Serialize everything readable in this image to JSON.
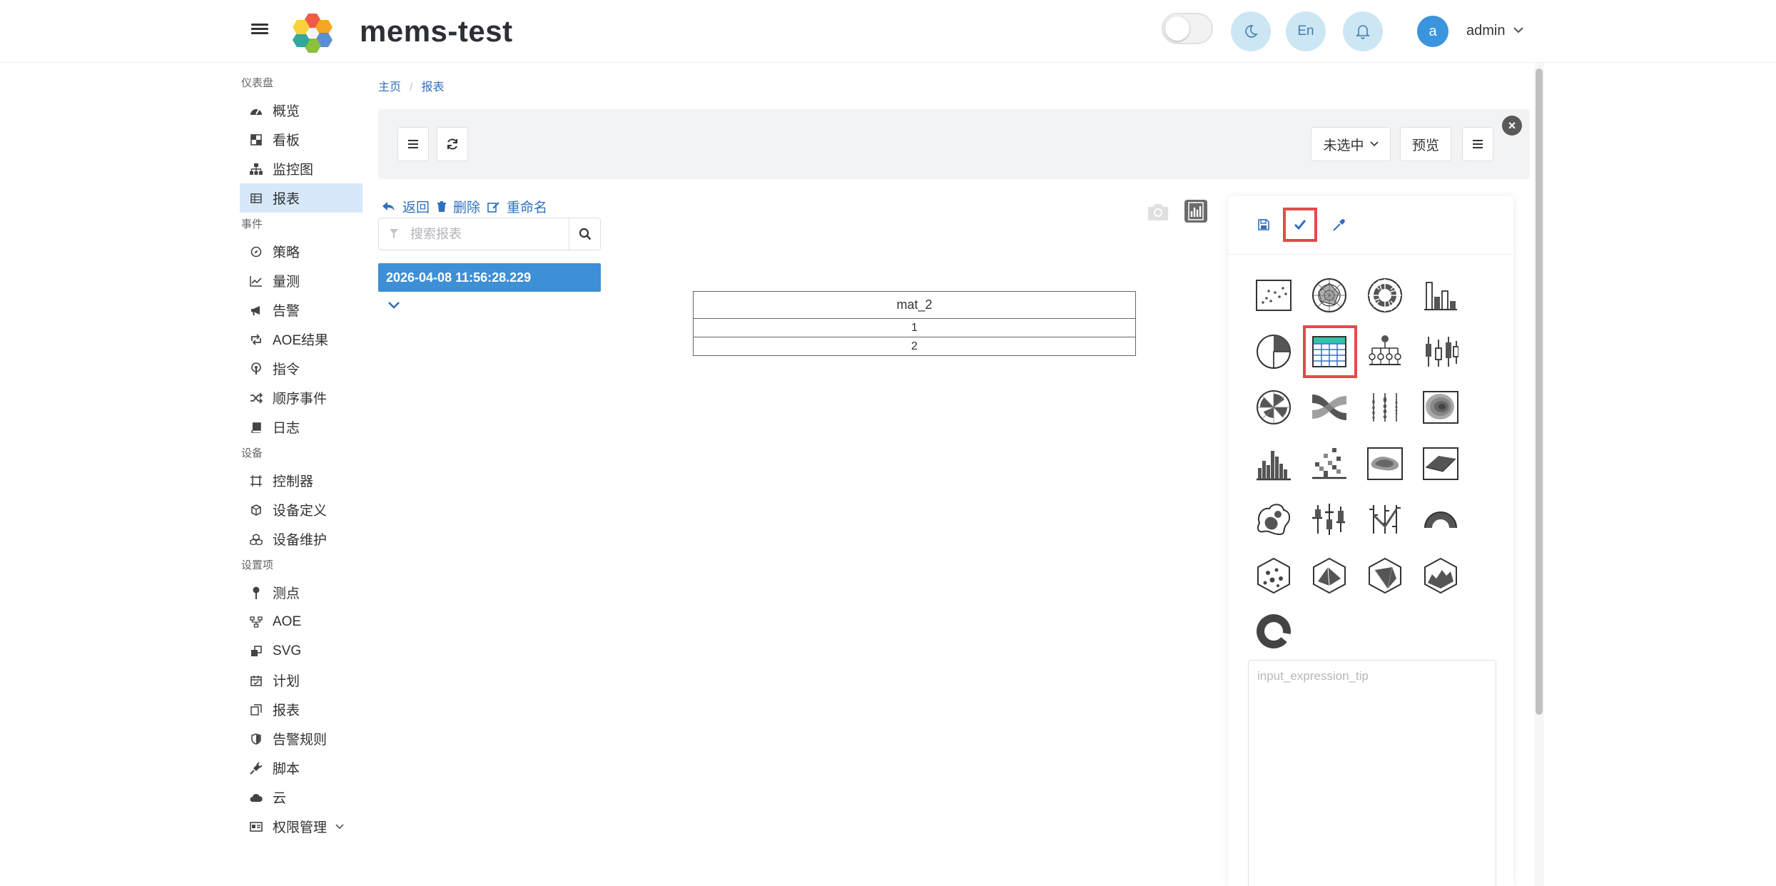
{
  "header": {
    "title": "mems-test",
    "lang_label": "En",
    "avatar_letter": "a",
    "user_name": "admin"
  },
  "sidebar": {
    "sections": [
      {
        "title": "仪表盘",
        "items": [
          {
            "label": "概览",
            "icon": "dashboard-icon"
          },
          {
            "label": "看板",
            "icon": "board-icon"
          },
          {
            "label": "监控图",
            "icon": "sitemap-icon"
          },
          {
            "label": "报表",
            "icon": "table-icon",
            "active": true
          }
        ]
      },
      {
        "title": "事件",
        "items": [
          {
            "label": "策略",
            "icon": "compass-icon"
          },
          {
            "label": "量测",
            "icon": "line-chart-icon"
          },
          {
            "label": "告警",
            "icon": "megaphone-icon"
          },
          {
            "label": "AOE结果",
            "icon": "retweet-icon"
          },
          {
            "label": "指令",
            "icon": "podcast-icon"
          },
          {
            "label": "顺序事件",
            "icon": "shuffle-icon"
          },
          {
            "label": "日志",
            "icon": "book-icon"
          }
        ]
      },
      {
        "title": "设备",
        "items": [
          {
            "label": "控制器",
            "icon": "controller-icon"
          },
          {
            "label": "设备定义",
            "icon": "cube-icon"
          },
          {
            "label": "设备维护",
            "icon": "cubes-icon"
          }
        ]
      },
      {
        "title": "设置项",
        "items": [
          {
            "label": "测点",
            "icon": "pin-icon"
          },
          {
            "label": "AOE",
            "icon": "flow-icon"
          },
          {
            "label": "SVG",
            "icon": "clone-icon"
          },
          {
            "label": "计划",
            "icon": "calendar-icon"
          },
          {
            "label": "报表",
            "icon": "copy-icon"
          },
          {
            "label": "告警规则",
            "icon": "shield-icon"
          },
          {
            "label": "脚本",
            "icon": "plug-icon"
          },
          {
            "label": "云",
            "icon": "cloud-icon"
          },
          {
            "label": "权限管理",
            "icon": "id-card-icon",
            "has_caret": true
          }
        ]
      }
    ]
  },
  "breadcrumb": {
    "home": "主页",
    "current": "报表"
  },
  "toolbar": {
    "select_label": "未选中",
    "preview_label": "预览"
  },
  "actions": {
    "back": "返回",
    "delete": "删除",
    "rename": "重命名"
  },
  "search": {
    "placeholder": "搜索报表"
  },
  "report_list": {
    "selected_item": "2026-04-08 11:56:28.229"
  },
  "table": {
    "header": "mat_2",
    "rows": [
      "1",
      "2"
    ]
  },
  "panel": {
    "chart_types": [
      "scatter-chart-icon",
      "radar-chart-icon",
      "sunburst-chart-icon",
      "bar-chart-icon",
      "pie-chart-icon",
      "table-chart-icon",
      "tree-chart-icon",
      "boxplot-chart-icon",
      "polar-chart-icon",
      "sankey-chart-icon",
      "violin-chart-icon",
      "contour-chart-icon",
      "histogram-chart-icon",
      "heatmap-chart-icon",
      "density-chart-icon",
      "surface-chart-icon",
      "blob-chart-icon",
      "candlestick-chart-icon",
      "ohlc-chart-icon",
      "gauge-chart-icon",
      "scatter3d-chart-icon",
      "mesh3d-chart-icon",
      "cone3d-chart-icon",
      "area3d-chart-icon",
      "ring-chart-icon"
    ],
    "selected_chart": "table-chart-icon",
    "expression_placeholder": "input_expression_tip"
  },
  "colors": {
    "accent": "#3d8fd6",
    "link": "#2f6fbf",
    "highlight": "#e24b4b",
    "active_nav": "#d6e8fa"
  }
}
